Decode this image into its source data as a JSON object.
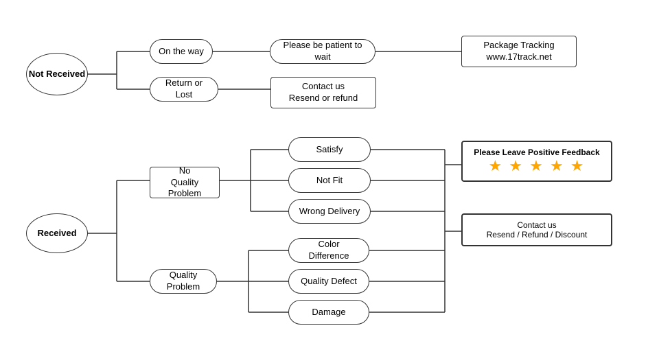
{
  "nodes": {
    "not_received": {
      "label": "Not\nReceived"
    },
    "on_the_way": {
      "label": "On the way"
    },
    "return_or_lost": {
      "label": "Return or Lost"
    },
    "be_patient": {
      "label": "Please be patient to wait"
    },
    "package_tracking": {
      "label": "Package Tracking\nwww.17track.net"
    },
    "contact_resend_refund": {
      "label": "Contact us\nResend or refund"
    },
    "received": {
      "label": "Received"
    },
    "no_quality_problem": {
      "label": "No\nQuality Problem"
    },
    "quality_problem": {
      "label": "Quality Problem"
    },
    "satisfy": {
      "label": "Satisfy"
    },
    "not_fit": {
      "label": "Not Fit"
    },
    "wrong_delivery": {
      "label": "Wrong Delivery"
    },
    "color_difference": {
      "label": "Color Difference"
    },
    "quality_defect": {
      "label": "Quality Defect"
    },
    "damage": {
      "label": "Damage"
    },
    "feedback_title": {
      "label": "Please Leave Positive Feedback"
    },
    "feedback_stars": {
      "label": "★ ★ ★ ★ ★"
    },
    "contact_resend_refund_discount_title": {
      "label": "Contact us"
    },
    "contact_resend_refund_discount_sub": {
      "label": "Resend / Refund / Discount"
    }
  }
}
